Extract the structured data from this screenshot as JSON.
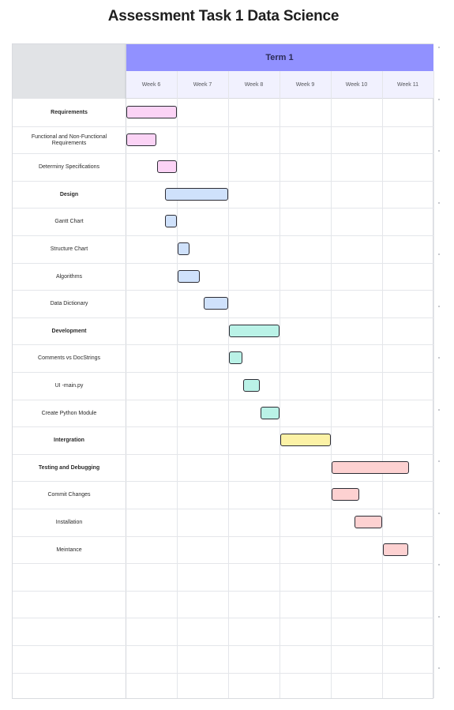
{
  "title": "Assessment Task 1 Data Science",
  "term": "Term 1",
  "weeks": [
    "Week 6",
    "Week 7",
    "Week 8",
    "Week 9",
    "Week 10",
    "Week 11"
  ],
  "tasks": [
    {
      "label": "Requirements",
      "group": true,
      "start": 0.0,
      "end": 1.0,
      "color": "#fbd3f5"
    },
    {
      "label": "Functional and Non-Functional Requirements",
      "group": false,
      "start": 0.0,
      "end": 0.6,
      "color": "#fbd3f5"
    },
    {
      "label": "Determiny Specifications",
      "group": false,
      "start": 0.6,
      "end": 1.0,
      "color": "#fbd3f5"
    },
    {
      "label": "Design",
      "group": true,
      "start": 0.75,
      "end": 2.0,
      "color": "#cfe1fb"
    },
    {
      "label": "Gantt Chart",
      "group": false,
      "start": 0.75,
      "end": 1.0,
      "color": "#cfe1fb"
    },
    {
      "label": "Structure Chart",
      "group": false,
      "start": 1.0,
      "end": 1.25,
      "color": "#cfe1fb"
    },
    {
      "label": "Algorithms",
      "group": false,
      "start": 1.0,
      "end": 1.45,
      "color": "#cfe1fb"
    },
    {
      "label": "Data Dictionary",
      "group": false,
      "start": 1.5,
      "end": 2.0,
      "color": "#cfe1fb"
    },
    {
      "label": "Development",
      "group": true,
      "start": 2.0,
      "end": 3.0,
      "color": "#baf2e7"
    },
    {
      "label": "Comments vs DocStrings",
      "group": false,
      "start": 2.0,
      "end": 2.27,
      "color": "#baf2e7"
    },
    {
      "label": "UI -main.py",
      "group": false,
      "start": 2.27,
      "end": 2.62,
      "color": "#baf2e7"
    },
    {
      "label": "Create Python Module",
      "group": false,
      "start": 2.62,
      "end": 3.0,
      "color": "#baf2e7"
    },
    {
      "label": "Intergration",
      "group": true,
      "start": 3.0,
      "end": 4.0,
      "color": "#fcf2a6"
    },
    {
      "label": "Testing and Debugging",
      "group": true,
      "start": 4.0,
      "end": 5.53,
      "color": "#fdd1d1"
    },
    {
      "label": "Commit Changes",
      "group": false,
      "start": 4.0,
      "end": 4.55,
      "color": "#fdd1d1"
    },
    {
      "label": "Installation",
      "group": false,
      "start": 4.45,
      "end": 5.0,
      "color": "#fdd1d1"
    },
    {
      "label": "Meintance",
      "group": false,
      "start": 5.0,
      "end": 5.5,
      "color": "#fdd1d1"
    }
  ],
  "empty_rows": 5
}
